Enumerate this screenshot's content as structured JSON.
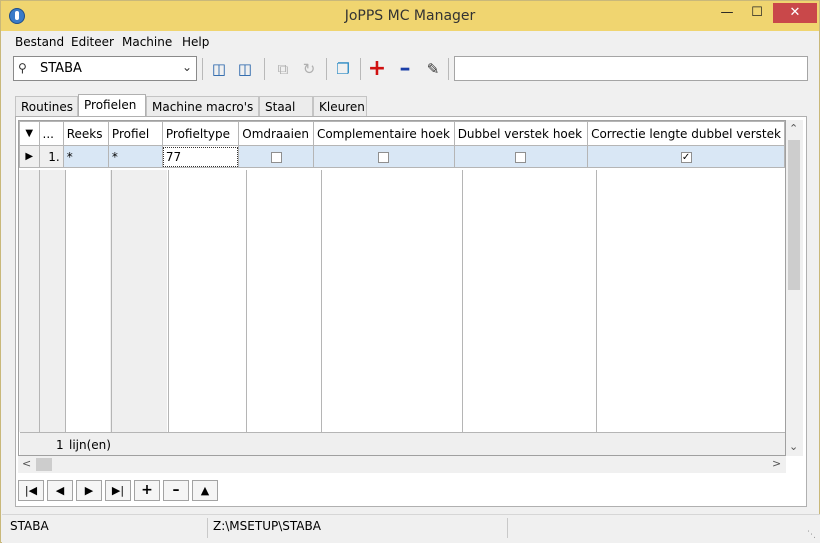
{
  "window": {
    "title": "JoPPS MC Manager",
    "controls": {
      "minimize": "—",
      "maximize": "☐",
      "close": "✕"
    }
  },
  "menu": [
    "Bestand",
    "Editeer",
    "Machine",
    "Help"
  ],
  "toolbar": {
    "machine_combo_value": "STABA",
    "search_value": "",
    "icons": [
      "database-import-icon",
      "database-export-icon",
      "copy-icon",
      "redo-icon",
      "cube-icon",
      "add-icon",
      "remove-icon",
      "edit-pencil-icon"
    ]
  },
  "tabs": [
    {
      "label": "Routines",
      "active": false
    },
    {
      "label": "Profielen",
      "active": true
    },
    {
      "label": "Machine macro's",
      "active": false
    },
    {
      "label": "Staal",
      "active": false
    },
    {
      "label": "Kleuren",
      "active": false
    }
  ],
  "grid": {
    "columns": [
      "",
      "...",
      "Reeks",
      "Profiel",
      "Profieltype",
      "Omdraaien",
      "Complementaire hoek",
      "Dubbel verstek hoek",
      "Correctie lengte dubbel verstek"
    ],
    "rows": [
      {
        "num": "1.",
        "reeks": "*",
        "profiel": "*",
        "profieltype": "77",
        "omdraaien": false,
        "complementaire_hoek": false,
        "dubbel_verstek_hoek": false,
        "correctie_lengte": true
      }
    ],
    "footer": {
      "count": "1",
      "label": "lijn(en)"
    }
  },
  "nav_buttons": [
    "first",
    "previous",
    "next",
    "last",
    "add",
    "remove",
    "up"
  ],
  "statusbar": {
    "machine": "STABA",
    "path": "Z:\\MSETUP\\STABA"
  },
  "colors": {
    "titlebar": "#f0d570",
    "selected_row": "#d9e7f5",
    "close_button": "#c9484a"
  }
}
